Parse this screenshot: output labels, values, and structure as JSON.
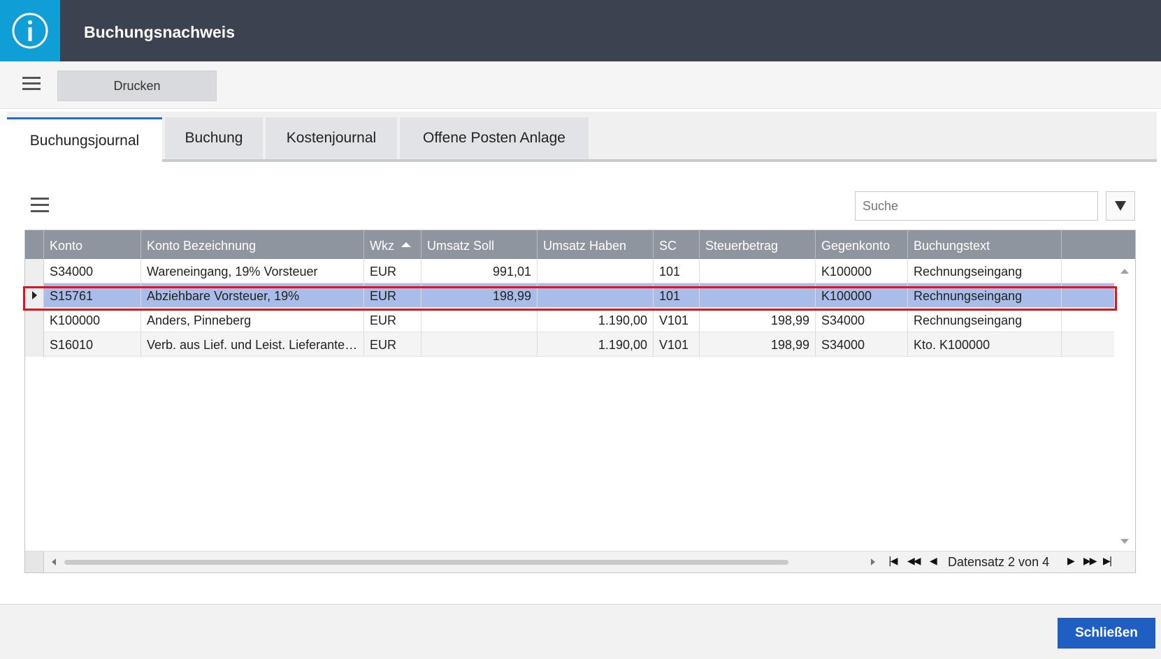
{
  "header": {
    "title": "Buchungsnachweis",
    "icon": "info-icon"
  },
  "toolbar": {
    "print_label": "Drucken"
  },
  "tabs": [
    {
      "label": "Buchungsjournal",
      "active": true
    },
    {
      "label": "Buchung",
      "active": false
    },
    {
      "label": "Kostenjournal",
      "active": false
    },
    {
      "label": "Offene Posten Anlage",
      "active": false
    }
  ],
  "search": {
    "placeholder": "Suche"
  },
  "grid": {
    "columns": [
      "Konto",
      "Konto Bezeichnung",
      "Wkz",
      "Umsatz Soll",
      "Umsatz Haben",
      "SC",
      "Steuerbetrag",
      "Gegenkonto",
      "Buchungstext"
    ],
    "sorted_column": "Wkz",
    "sort_direction": "ascending",
    "rows": [
      [
        "S34000",
        "Wareneingang, 19% Vorsteuer",
        "EUR",
        "991,01",
        "",
        "101",
        "",
        "K100000",
        "Rechnungseingang"
      ],
      [
        "S15761",
        "Abziehbare Vorsteuer, 19%",
        "EUR",
        "198,99",
        "",
        "101",
        "",
        "K100000",
        "Rechnungseingang"
      ],
      [
        "K100000",
        "Anders, Pinneberg",
        "EUR",
        "",
        "1.190,00",
        "V101",
        "198,99",
        "S34000",
        "Rechnungseingang"
      ],
      [
        "S16010",
        "Verb. aus Lief. und Leist. Lieferanten...",
        "EUR",
        "",
        "1.190,00",
        "V101",
        "198,99",
        "S34000",
        "Kto. K100000"
      ]
    ],
    "selected_row": 2,
    "record_info": "Datensatz 2 von 4"
  },
  "footer": {
    "close_label": "Schließen"
  },
  "colors": {
    "header_bg": "#3c4250",
    "icon_bg": "#0f9fd6",
    "selected_row": "#a9bde8",
    "highlight_outline": "#e1141e",
    "primary_button": "#1f5fc4"
  }
}
